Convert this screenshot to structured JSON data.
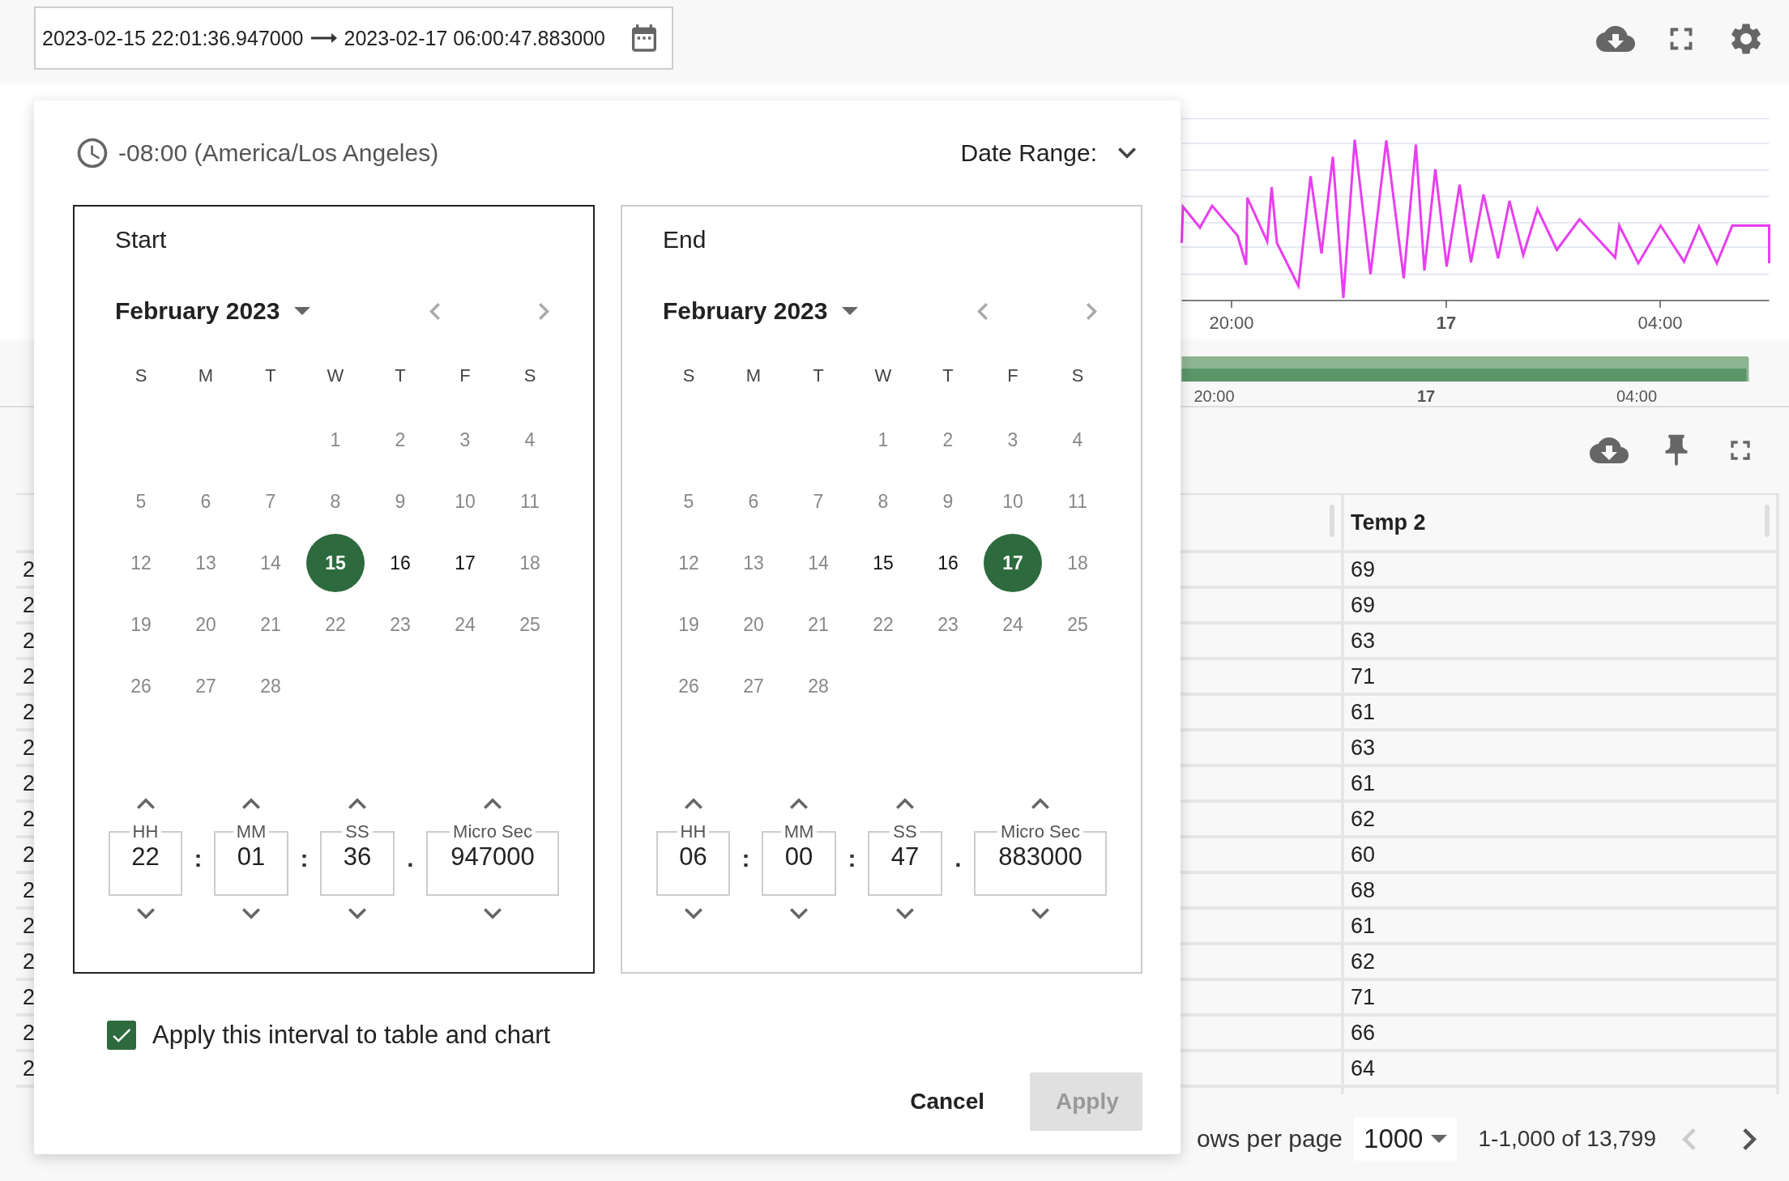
{
  "date_range_field": {
    "start": "2023-02-15 22:01:36.947000",
    "end": "2023-02-17 06:00:47.883000"
  },
  "chart": {
    "x_labels": [
      {
        "label": "20:00",
        "kind": "time"
      },
      {
        "label": "17",
        "kind": "day"
      },
      {
        "label": "04:00",
        "kind": "time"
      }
    ]
  },
  "navigator": {
    "x_labels": [
      {
        "label": "20:00",
        "kind": "time"
      },
      {
        "label": "17",
        "kind": "day"
      },
      {
        "label": "04:00",
        "kind": "time"
      }
    ]
  },
  "table": {
    "columns": [
      "Temp 2"
    ],
    "rows": [
      {
        "column_1": "2",
        "temp_2": "69"
      },
      {
        "column_1": "2",
        "temp_2": "69"
      },
      {
        "column_1": "2",
        "temp_2": "63"
      },
      {
        "column_1": "2",
        "temp_2": "71"
      },
      {
        "column_1": "2",
        "temp_2": "61"
      },
      {
        "column_1": "2",
        "temp_2": "63"
      },
      {
        "column_1": "2",
        "temp_2": "61"
      },
      {
        "column_1": "2",
        "temp_2": "62"
      },
      {
        "column_1": "2",
        "temp_2": "60"
      },
      {
        "column_1": "2",
        "temp_2": "68"
      },
      {
        "column_1": "2",
        "temp_2": "61"
      },
      {
        "column_1": "2",
        "temp_2": "62"
      },
      {
        "column_1": "2",
        "temp_2": "71"
      },
      {
        "column_1": "2",
        "temp_2": "66"
      },
      {
        "column_1": "2",
        "temp_2": "64"
      }
    ]
  },
  "pagination": {
    "rows_per_page_label": "ows per page",
    "rows_per_page": "1000",
    "range": "1-1,000 of 13,799",
    "prev_disabled": true,
    "next_disabled": false
  },
  "dialog": {
    "timezone": "-08:00 (America/Los Angeles)",
    "date_range_label": "Date Range:",
    "calendars": [
      {
        "title": "Start",
        "active": true,
        "month": "February 2023",
        "weekdays": [
          "S",
          "M",
          "T",
          "W",
          "T",
          "F",
          "S"
        ],
        "days": [
          {
            "kind": "blank"
          },
          {
            "kind": "blank"
          },
          {
            "kind": "blank"
          },
          {
            "kind": "day",
            "label": "1",
            "selected": false,
            "disabled": true
          },
          {
            "kind": "day",
            "label": "2",
            "selected": false,
            "disabled": true
          },
          {
            "kind": "day",
            "label": "3",
            "selected": false,
            "disabled": true
          },
          {
            "kind": "day",
            "label": "4",
            "selected": false,
            "disabled": true
          },
          {
            "kind": "day",
            "label": "5",
            "selected": false,
            "disabled": true
          },
          {
            "kind": "day",
            "label": "6",
            "selected": false,
            "disabled": true
          },
          {
            "kind": "day",
            "label": "7",
            "selected": false,
            "disabled": true
          },
          {
            "kind": "day",
            "label": "8",
            "selected": false,
            "disabled": true
          },
          {
            "kind": "day",
            "label": "9",
            "selected": false,
            "disabled": true
          },
          {
            "kind": "day",
            "label": "10",
            "selected": false,
            "disabled": true
          },
          {
            "kind": "day",
            "label": "11",
            "selected": false,
            "disabled": true
          },
          {
            "kind": "day",
            "label": "12",
            "selected": false,
            "disabled": true
          },
          {
            "kind": "day",
            "label": "13",
            "selected": false,
            "disabled": true
          },
          {
            "kind": "day",
            "label": "14",
            "selected": false,
            "disabled": true
          },
          {
            "kind": "day",
            "label": "15",
            "selected": true,
            "disabled": false
          },
          {
            "kind": "day",
            "label": "16",
            "selected": false,
            "disabled": false
          },
          {
            "kind": "day",
            "label": "17",
            "selected": false,
            "disabled": false
          },
          {
            "kind": "day",
            "label": "18",
            "selected": false,
            "disabled": true
          },
          {
            "kind": "day",
            "label": "19",
            "selected": false,
            "disabled": true
          },
          {
            "kind": "day",
            "label": "20",
            "selected": false,
            "disabled": true
          },
          {
            "kind": "day",
            "label": "21",
            "selected": false,
            "disabled": true
          },
          {
            "kind": "day",
            "label": "22",
            "selected": false,
            "disabled": true
          },
          {
            "kind": "day",
            "label": "23",
            "selected": false,
            "disabled": true
          },
          {
            "kind": "day",
            "label": "24",
            "selected": false,
            "disabled": true
          },
          {
            "kind": "day",
            "label": "25",
            "selected": false,
            "disabled": true
          },
          {
            "kind": "day",
            "label": "26",
            "selected": false,
            "disabled": true
          },
          {
            "kind": "day",
            "label": "27",
            "selected": false,
            "disabled": true
          },
          {
            "kind": "day",
            "label": "28",
            "selected": false,
            "disabled": true
          }
        ],
        "time": [
          {
            "label": "HH",
            "value": "22",
            "separator": ":"
          },
          {
            "label": "MM",
            "value": "01",
            "separator": ":"
          },
          {
            "label": "SS",
            "value": "36",
            "separator": "."
          },
          {
            "label": "Micro Sec",
            "value": "947000"
          }
        ]
      },
      {
        "title": "End",
        "active": false,
        "month": "February 2023",
        "weekdays": [
          "S",
          "M",
          "T",
          "W",
          "T",
          "F",
          "S"
        ],
        "days": [
          {
            "kind": "blank"
          },
          {
            "kind": "blank"
          },
          {
            "kind": "blank"
          },
          {
            "kind": "day",
            "label": "1",
            "selected": false,
            "disabled": true
          },
          {
            "kind": "day",
            "label": "2",
            "selected": false,
            "disabled": true
          },
          {
            "kind": "day",
            "label": "3",
            "selected": false,
            "disabled": true
          },
          {
            "kind": "day",
            "label": "4",
            "selected": false,
            "disabled": true
          },
          {
            "kind": "day",
            "label": "5",
            "selected": false,
            "disabled": true
          },
          {
            "kind": "day",
            "label": "6",
            "selected": false,
            "disabled": true
          },
          {
            "kind": "day",
            "label": "7",
            "selected": false,
            "disabled": true
          },
          {
            "kind": "day",
            "label": "8",
            "selected": false,
            "disabled": true
          },
          {
            "kind": "day",
            "label": "9",
            "selected": false,
            "disabled": true
          },
          {
            "kind": "day",
            "label": "10",
            "selected": false,
            "disabled": true
          },
          {
            "kind": "day",
            "label": "11",
            "selected": false,
            "disabled": true
          },
          {
            "kind": "day",
            "label": "12",
            "selected": false,
            "disabled": true
          },
          {
            "kind": "day",
            "label": "13",
            "selected": false,
            "disabled": true
          },
          {
            "kind": "day",
            "label": "14",
            "selected": false,
            "disabled": true
          },
          {
            "kind": "day",
            "label": "15",
            "selected": false,
            "disabled": false
          },
          {
            "kind": "day",
            "label": "16",
            "selected": false,
            "disabled": false
          },
          {
            "kind": "day",
            "label": "17",
            "selected": true,
            "disabled": false
          },
          {
            "kind": "day",
            "label": "18",
            "selected": false,
            "disabled": true
          },
          {
            "kind": "day",
            "label": "19",
            "selected": false,
            "disabled": true
          },
          {
            "kind": "day",
            "label": "20",
            "selected": false,
            "disabled": true
          },
          {
            "kind": "day",
            "label": "21",
            "selected": false,
            "disabled": true
          },
          {
            "kind": "day",
            "label": "22",
            "selected": false,
            "disabled": true
          },
          {
            "kind": "day",
            "label": "23",
            "selected": false,
            "disabled": true
          },
          {
            "kind": "day",
            "label": "24",
            "selected": false,
            "disabled": true
          },
          {
            "kind": "day",
            "label": "25",
            "selected": false,
            "disabled": true
          },
          {
            "kind": "day",
            "label": "26",
            "selected": false,
            "disabled": true
          },
          {
            "kind": "day",
            "label": "27",
            "selected": false,
            "disabled": true
          },
          {
            "kind": "day",
            "label": "28",
            "selected": false,
            "disabled": true
          }
        ],
        "time": [
          {
            "label": "HH",
            "value": "06",
            "separator": ":"
          },
          {
            "label": "MM",
            "value": "00",
            "separator": ":"
          },
          {
            "label": "SS",
            "value": "47",
            "separator": "."
          },
          {
            "label": "Micro Sec",
            "value": "883000"
          }
        ]
      }
    ],
    "apply_option": {
      "label": "Apply this interval to table and chart",
      "checked": true
    },
    "buttons": [
      {
        "label": "Cancel",
        "kind": "text",
        "disabled": false
      },
      {
        "label": "Apply",
        "kind": "filled",
        "disabled": true
      }
    ]
  }
}
